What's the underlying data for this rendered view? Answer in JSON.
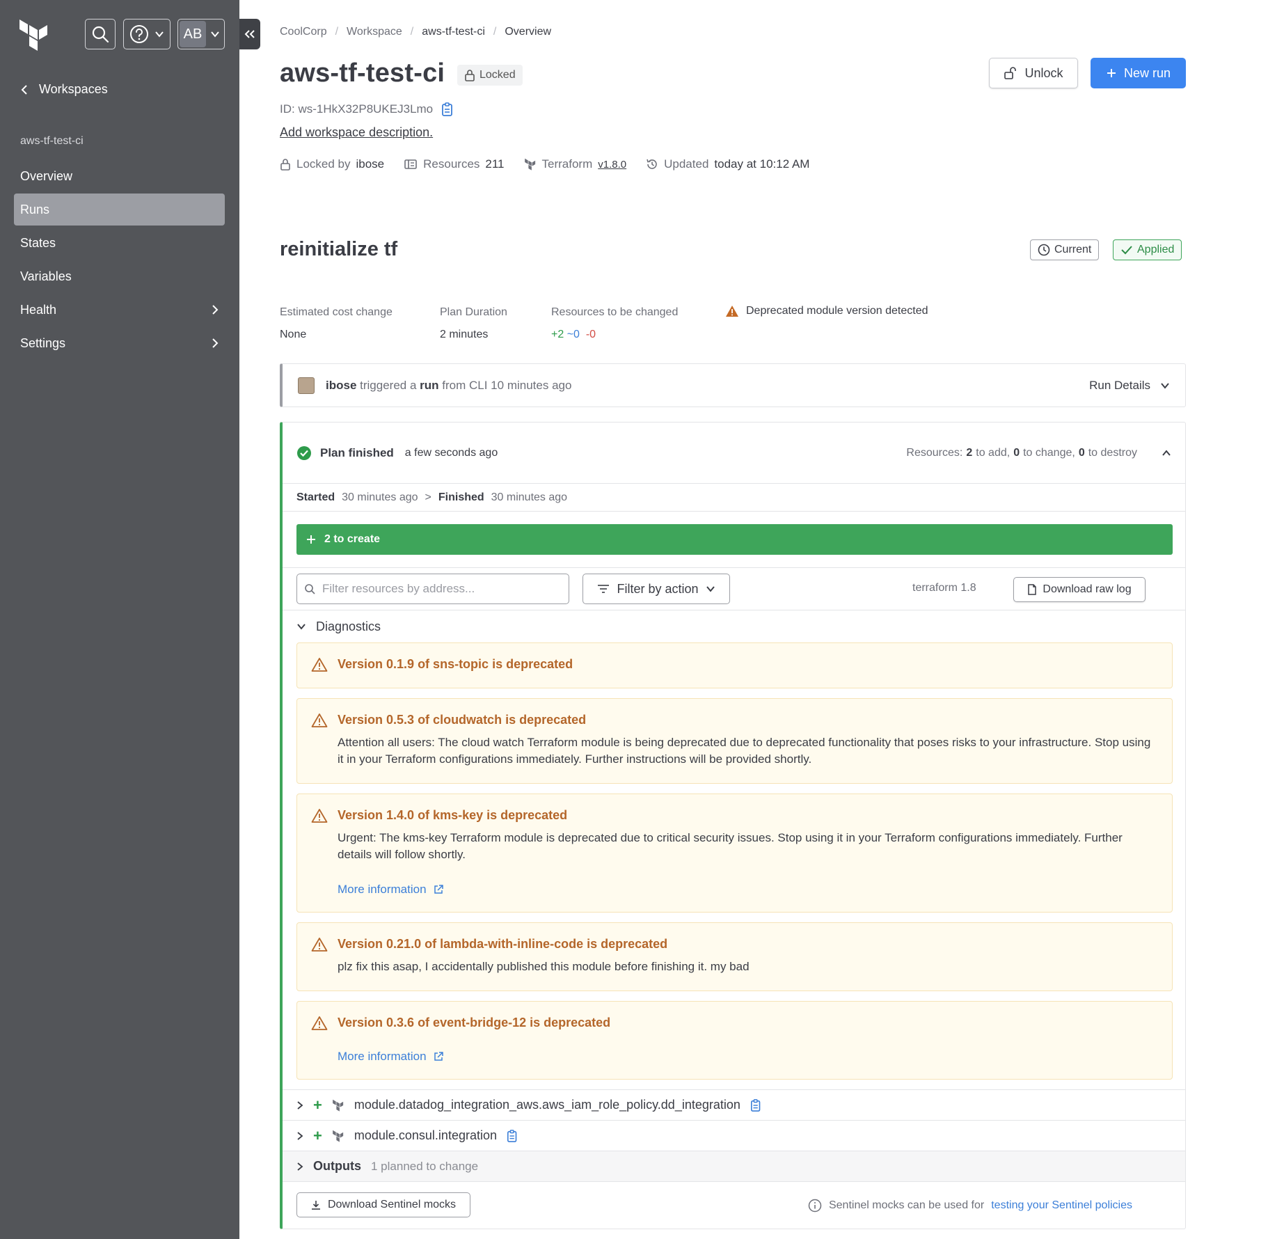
{
  "sidebar": {
    "avatar_initials": "AB",
    "back_label": "Workspaces",
    "workspace_name": "aws-tf-test-ci",
    "items": [
      {
        "label": "Overview"
      },
      {
        "label": "Runs"
      },
      {
        "label": "States"
      },
      {
        "label": "Variables"
      },
      {
        "label": "Health"
      },
      {
        "label": "Settings"
      }
    ]
  },
  "breadcrumbs": [
    "CoolCorp",
    "Workspace",
    "aws-tf-test-ci",
    "Overview"
  ],
  "workspace": {
    "title": "aws-tf-test-ci",
    "locked_badge": "Locked",
    "id": "ID: ws-1HkX32P8UKEJ3Lmo",
    "add_description": "Add workspace description.",
    "unlock_label": "Unlock",
    "new_run_label": "New run",
    "meta": {
      "locked_by_label": "Locked by",
      "locked_by_user": "ibose",
      "resources_label": "Resources",
      "resources_count": "211",
      "terraform_label": "Terraform",
      "terraform_version": "v1.8.0",
      "updated_label": "Updated",
      "updated_value": "today at 10:12 AM"
    }
  },
  "run": {
    "title": "reinitialize tf",
    "current_label": "Current",
    "applied_label": "Applied",
    "stats": {
      "cost_label": "Estimated cost change",
      "cost_value": "None",
      "duration_label": "Plan Duration",
      "duration_value": "2 minutes",
      "resources_label": "Resources to be changed",
      "add": "+2",
      "change": "~0",
      "destroy": "-0",
      "deprecated_notice": "Deprecated module version detected"
    },
    "trigger": {
      "user": "ibose",
      "t1": "triggered a",
      "run_word": "run",
      "t2": "from CLI 10 minutes ago",
      "details_label": "Run Details"
    }
  },
  "plan": {
    "status": "Plan finished",
    "ago": "a few seconds ago",
    "resources_prefix": "Resources:",
    "add_count": "2",
    "add_text": "to add,",
    "change_count": "0",
    "change_text": "to change,",
    "destroy_count": "0",
    "destroy_text": "to destroy",
    "started_label": "Started",
    "started_value": "30 minutes ago",
    "finished_label": "Finished",
    "finished_value": "30 minutes ago",
    "create_bar": "2 to create",
    "filter_placeholder": "Filter resources by address...",
    "filter_action_label": "Filter by action",
    "terraform_version": "terraform 1.8",
    "download_log_label": "Download raw log",
    "diagnostics_label": "Diagnostics",
    "warnings": [
      {
        "title": "Version 0.1.9 of sns-topic is deprecated"
      },
      {
        "title": "Version 0.5.3 of cloudwatch is deprecated",
        "detail": "Attention all users: The cloud watch Terraform module is being deprecated due to deprecated functionality that poses risks to your infrastructure. Stop using it in your Terraform configurations immediately. Further instructions will be provided shortly."
      },
      {
        "title": "Version 1.4.0 of kms-key is deprecated",
        "detail": "Urgent: The kms-key Terraform module is deprecated due to critical security issues. Stop using it in your Terraform configurations immediately. Further details will follow shortly.",
        "link": "More information"
      },
      {
        "title": "Version 0.21.0 of lambda-with-inline-code is deprecated",
        "detail": "plz fix this asap, I accidentally published this module before finishing it. my bad"
      },
      {
        "title": "Version 0.3.6 of event-bridge-12 is deprecated",
        "link": "More information"
      }
    ],
    "resources": [
      {
        "address": "module.datadog_integration_aws.aws_iam_role_policy.dd_integration"
      },
      {
        "address": "module.consul.integration"
      }
    ],
    "outputs_label": "Outputs",
    "outputs_summary": "1 planned to change",
    "sentinel_button": "Download Sentinel mocks",
    "sentinel_note": "Sentinel mocks can be used for",
    "sentinel_link": "testing your Sentinel policies"
  },
  "colors": {
    "sidebar_bg": "#535559",
    "primary_blue": "#3c85f0",
    "success_green": "#3ea55a",
    "warning_orange": "#b4662a",
    "warning_bg": "#fffbee"
  }
}
